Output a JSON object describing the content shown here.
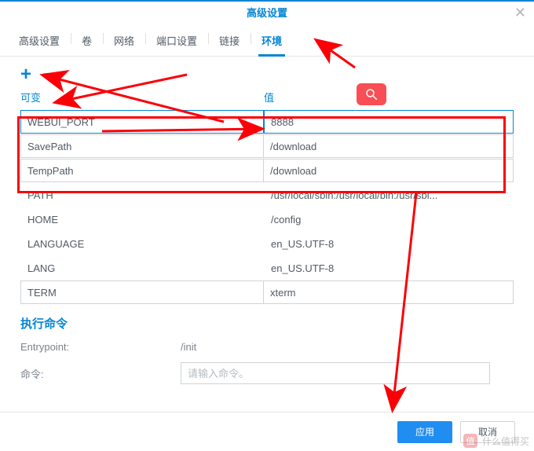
{
  "window": {
    "title": "高级设置",
    "close_glyph": "✕"
  },
  "tabs": [
    {
      "label": "高级设置"
    },
    {
      "label": "卷"
    },
    {
      "label": "网络"
    },
    {
      "label": "端口设置"
    },
    {
      "label": "链接"
    },
    {
      "label": "环境",
      "active": true
    }
  ],
  "toolbar": {
    "plus": "+",
    "minus": "−"
  },
  "columns": {
    "var": "可变",
    "val": "值"
  },
  "env": [
    {
      "name": "WEBUI_PORT",
      "value": "8888",
      "boxed": true,
      "editing": true
    },
    {
      "name": "SavePath",
      "value": "/download",
      "boxed": true
    },
    {
      "name": "TempPath",
      "value": "/download",
      "boxed": true
    },
    {
      "name": "PATH",
      "value": "/usr/local/sbin:/usr/local/bin:/usr/sbi..."
    },
    {
      "name": "HOME",
      "value": "/config"
    },
    {
      "name": "LANGUAGE",
      "value": "en_US.UTF-8"
    },
    {
      "name": "LANG",
      "value": "en_US.UTF-8"
    },
    {
      "name": "TERM",
      "value": "xterm",
      "boxed": true
    }
  ],
  "section": {
    "title": "执行命令"
  },
  "form": {
    "entrypoint_label": "Entrypoint:",
    "entrypoint_value": "/init",
    "command_label": "命令:",
    "command_placeholder": "请输入命令。"
  },
  "footer": {
    "apply": "应用",
    "cancel": "取消"
  },
  "watermark": {
    "icon": "值",
    "text": "什么值得买"
  }
}
